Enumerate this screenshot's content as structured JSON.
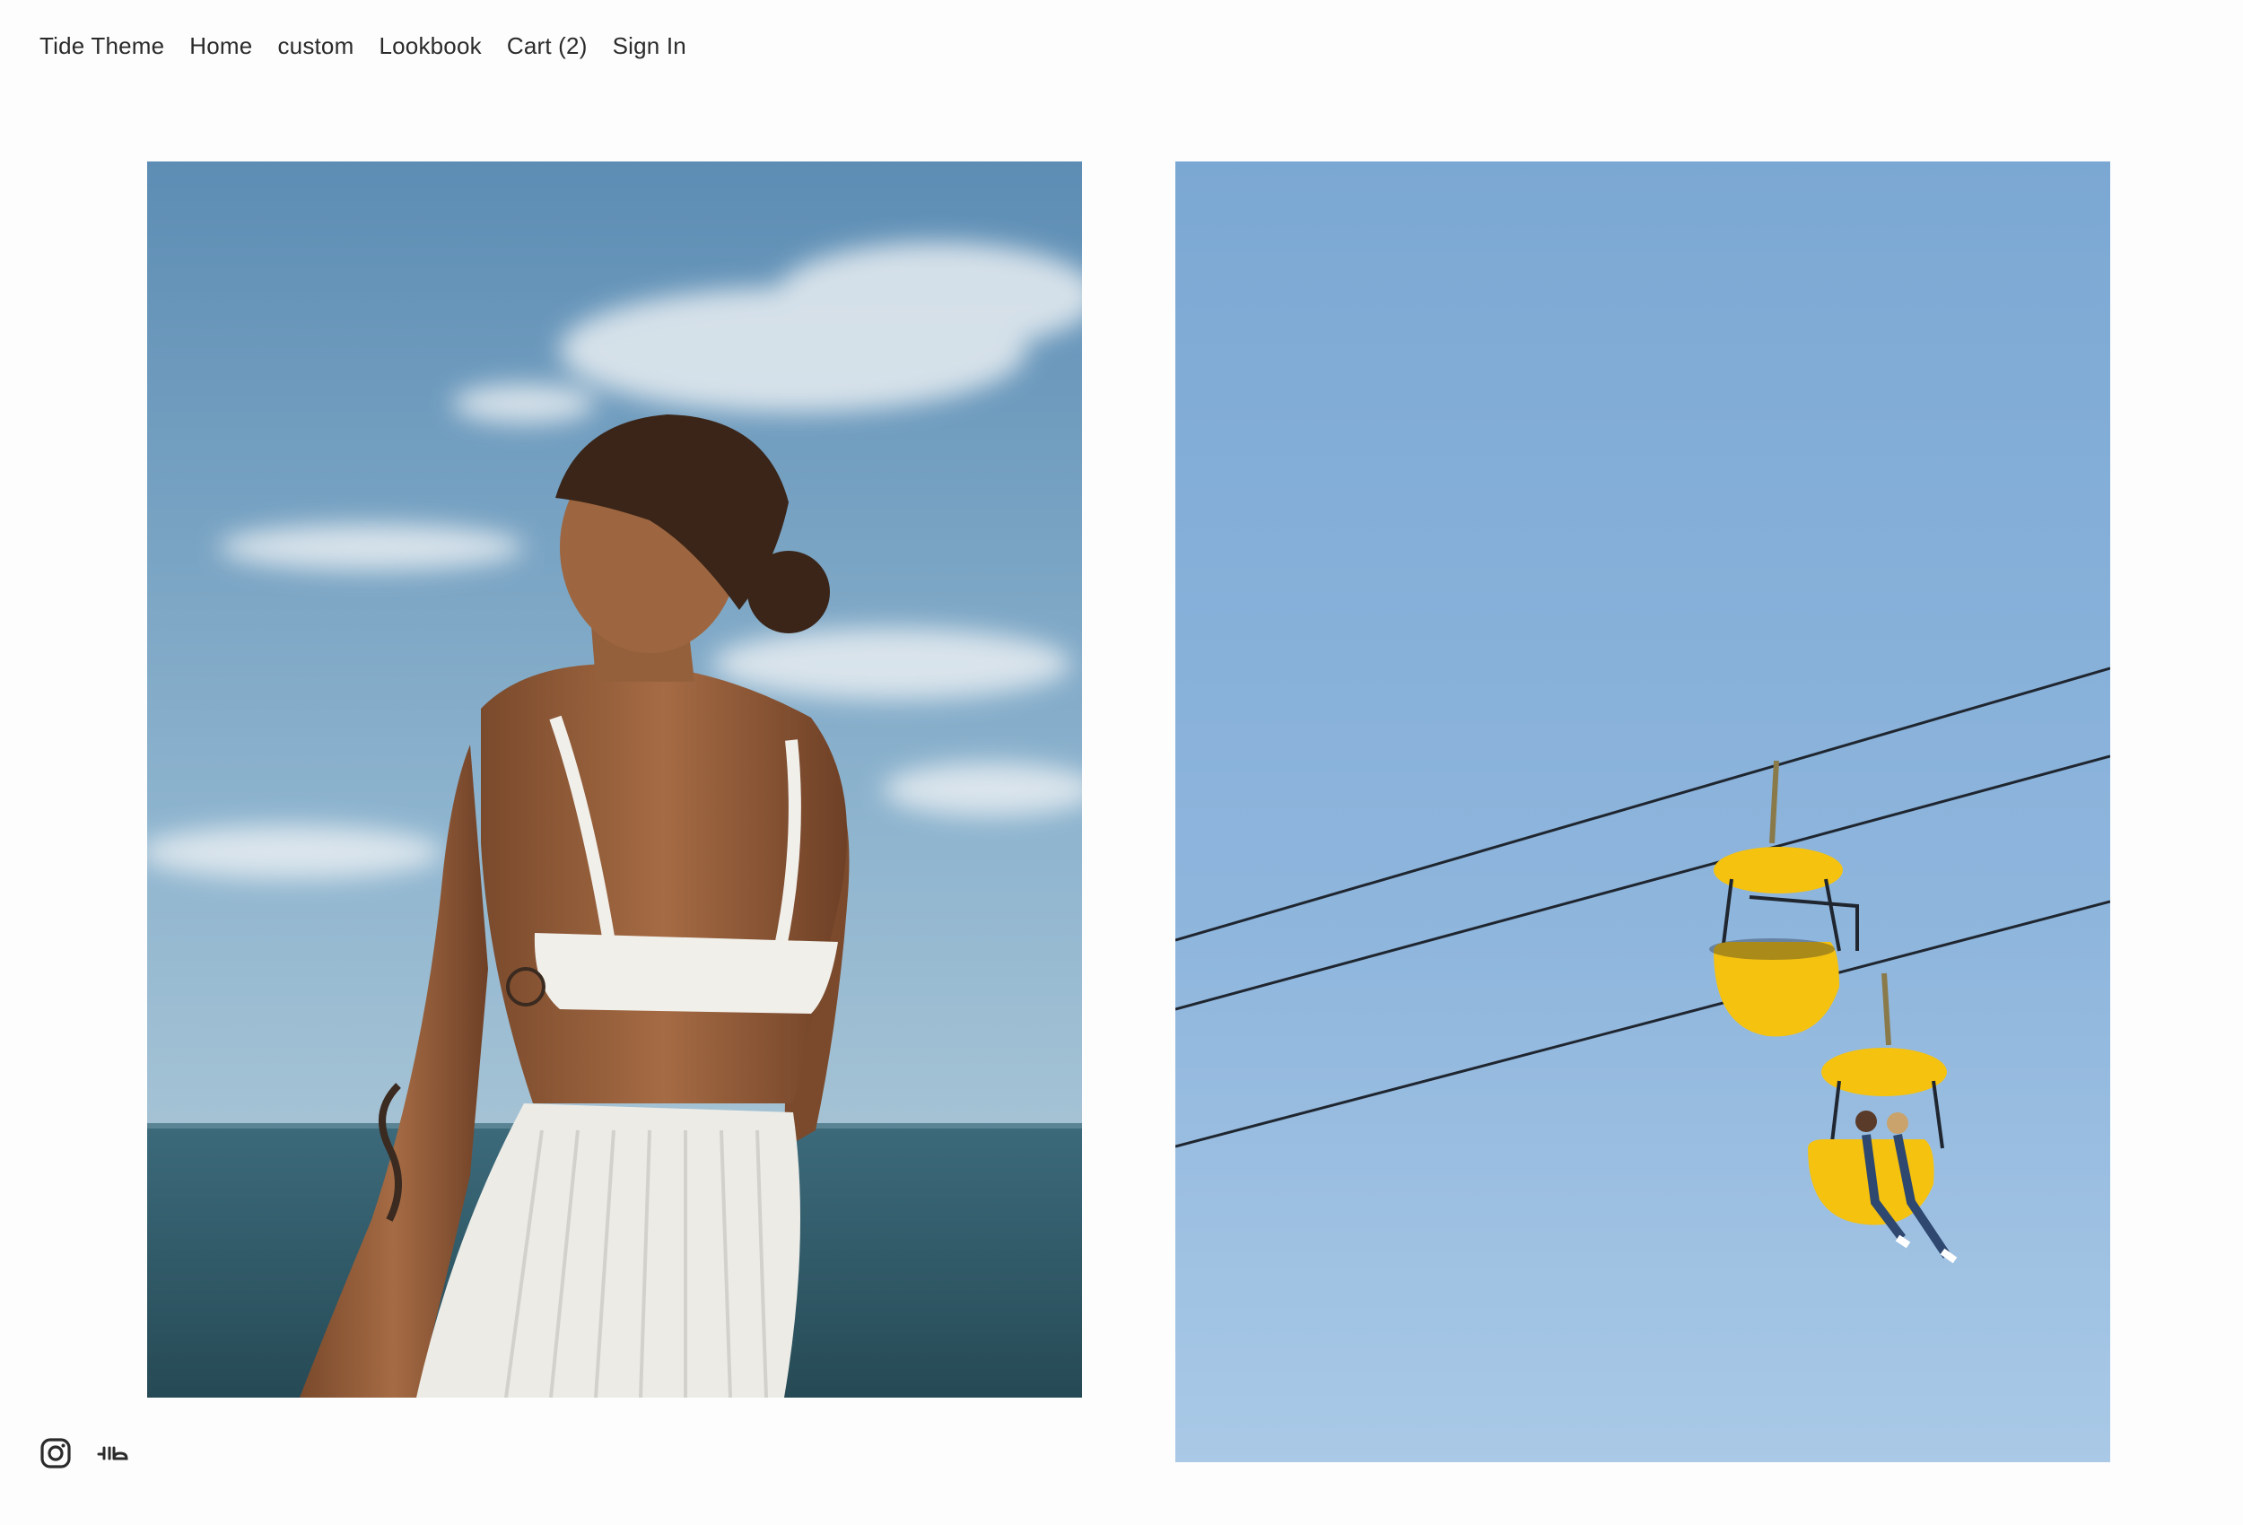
{
  "nav": {
    "brand": "Tide Theme",
    "items": [
      {
        "label": "Home"
      },
      {
        "label": "custom"
      },
      {
        "label": "Lookbook"
      },
      {
        "label": "Cart (2)"
      },
      {
        "label": "Sign In"
      }
    ]
  },
  "gallery": {
    "images": [
      {
        "subject": "woman-by-sea",
        "colors": {
          "sky": "#7aa6c4",
          "sea": "#3f6b7a",
          "fabric": "#f1efea"
        }
      },
      {
        "subject": "yellow-sky-gondolas",
        "colors": {
          "sky": "#8ab3da",
          "gondola": "#f5c20f"
        }
      }
    ]
  },
  "social": [
    {
      "icon": "instagram-icon"
    },
    {
      "icon": "ello-icon"
    }
  ]
}
